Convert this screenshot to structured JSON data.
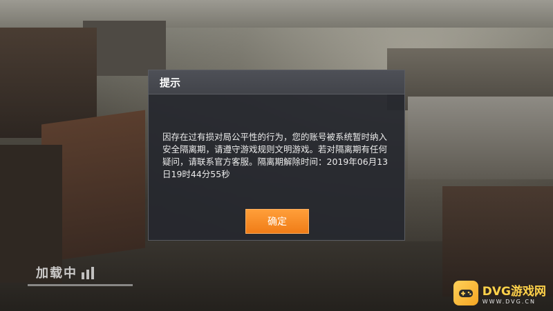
{
  "dialog": {
    "title": "提示",
    "message": "因存在过有损对局公平性的行为，您的账号被系统暂时纳入安全隔离期，请遵守游戏规则文明游戏。若对隔离期有任何疑问，请联系官方客服。隔离期解除时间：2019年06月13日19时44分55秒",
    "confirm_label": "确定"
  },
  "loading": {
    "label": "加载中"
  },
  "colors": {
    "accent": "#f5891f",
    "dialog_bg": "#26282e",
    "watermark_yellow": "#ffd24a"
  },
  "watermark": {
    "name": "DVG游戏网",
    "url": "WWW.DVG.CN",
    "icon": "gamepad-icon"
  }
}
